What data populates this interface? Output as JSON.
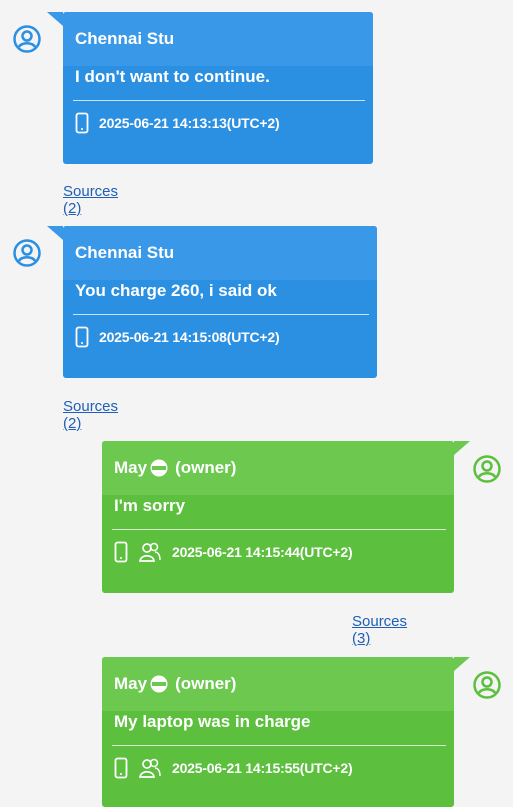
{
  "messages": [
    {
      "side": "left",
      "sender": "Chennai Stu",
      "text": "I don't want to continue.",
      "timestamp": "2025-06-21 14:13:13(UTC+2)",
      "sources_label": "Sources (2)",
      "icons": [
        "phone-icon"
      ]
    },
    {
      "side": "left",
      "sender": "Chennai Stu",
      "text": "You charge 260, i said ok",
      "timestamp": "2025-06-21 14:15:08(UTC+2)",
      "sources_label": "Sources (2)",
      "icons": [
        "phone-icon"
      ]
    },
    {
      "side": "right",
      "sender": "May",
      "sender_suffix": "(owner)",
      "text": "I'm sorry",
      "timestamp": "2025-06-21 14:15:44(UTC+2)",
      "sources_label": "Sources (3)",
      "icons": [
        "phone-icon",
        "group-icon"
      ]
    },
    {
      "side": "right",
      "sender": "May",
      "sender_suffix": "(owner)",
      "text": "My laptop was in charge",
      "timestamp": "2025-06-21 14:15:55(UTC+2)",
      "icons": [
        "phone-icon",
        "group-icon"
      ]
    }
  ],
  "colors": {
    "incoming_bubble": "#2b8fe2",
    "outgoing_bubble": "#5cbf3e",
    "link": "#1f5fb7",
    "incoming_avatar": "#2b8fe2",
    "outgoing_avatar": "#5cbf3e"
  }
}
